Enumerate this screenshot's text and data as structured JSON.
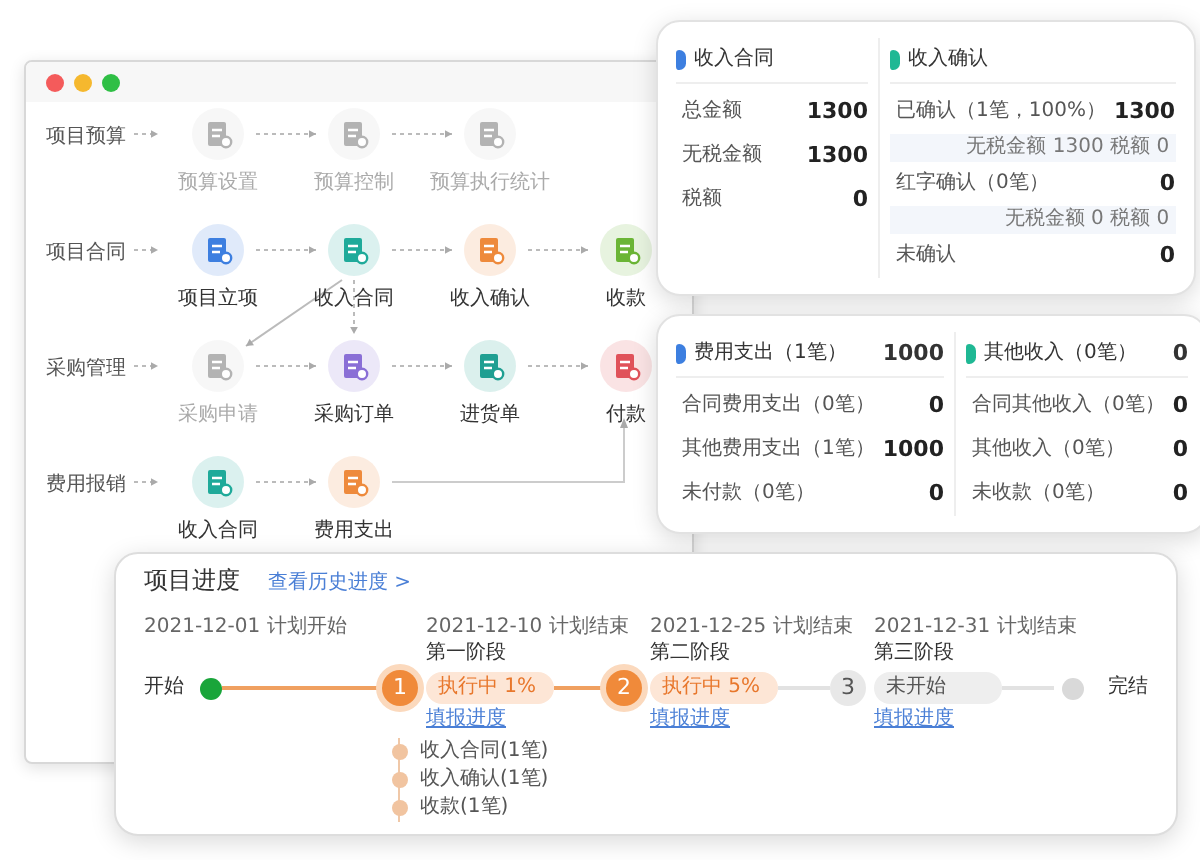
{
  "flow": {
    "rows": [
      {
        "label": "项目预算",
        "nodes": [
          {
            "label": "预算设置",
            "disabled": true,
            "color": "#b3b3b3"
          },
          {
            "label": "预算控制",
            "disabled": true,
            "color": "#b3b3b3"
          },
          {
            "label": "预算执行统计",
            "disabled": true,
            "color": "#b3b3b3"
          }
        ]
      },
      {
        "label": "项目合同",
        "nodes": [
          {
            "label": "项目立项",
            "disabled": false,
            "color": "#3d7fe0"
          },
          {
            "label": "收入合同",
            "disabled": false,
            "color": "#1faa9a"
          },
          {
            "label": "收入确认",
            "disabled": false,
            "color": "#ee8a3c"
          },
          {
            "label": "收款",
            "disabled": false,
            "color": "#6bb536"
          }
        ]
      },
      {
        "label": "采购管理",
        "nodes": [
          {
            "label": "采购申请",
            "disabled": true,
            "color": "#b3b3b3"
          },
          {
            "label": "采购订单",
            "disabled": false,
            "color": "#8a6fd6"
          },
          {
            "label": "进货单",
            "disabled": false,
            "color": "#1f9f92"
          },
          {
            "label": "付款",
            "disabled": false,
            "color": "#e0525a"
          }
        ]
      },
      {
        "label": "费用报销",
        "nodes": [
          {
            "label": "收入合同",
            "disabled": false,
            "color": "#1faa9a"
          },
          {
            "label": "费用支出",
            "disabled": false,
            "color": "#ee8a3c"
          }
        ]
      }
    ]
  },
  "summary_cards": [
    {
      "sections": [
        {
          "title": "收入合同",
          "color": "#3d7fe0",
          "rows": [
            {
              "kind": "row",
              "label": "总金额",
              "value": "1300"
            },
            {
              "kind": "row",
              "label": "无税金额",
              "value": "1300"
            },
            {
              "kind": "row",
              "label": "税额",
              "value": "0"
            }
          ]
        },
        {
          "title": "收入确认",
          "color": "#1fb894",
          "rows": [
            {
              "kind": "row",
              "label": "已确认（1笔，100%）",
              "value": "1300"
            },
            {
              "kind": "note",
              "label": "无税金额 1300 税额 0"
            },
            {
              "kind": "row",
              "label": "红字确认（0笔）",
              "value": "0"
            },
            {
              "kind": "note",
              "label": "无税金额 0 税额 0"
            },
            {
              "kind": "row",
              "label": "未确认",
              "value": "0"
            }
          ]
        }
      ]
    },
    {
      "sections": [
        {
          "title": "费用支出（1笔）",
          "total": "1000",
          "color": "#3d7fe0",
          "rows": [
            {
              "kind": "row",
              "label": "合同费用支出（0笔）",
              "value": "0"
            },
            {
              "kind": "row",
              "label": "其他费用支出（1笔）",
              "value": "1000"
            },
            {
              "kind": "row",
              "label": "未付款（0笔）",
              "value": "0"
            }
          ]
        },
        {
          "title": "其他收入（0笔）",
          "total": "0",
          "color": "#1fb894",
          "rows": [
            {
              "kind": "row",
              "label": "合同其他收入（0笔）",
              "value": "0"
            },
            {
              "kind": "row",
              "label": "其他收入（0笔）",
              "value": "0"
            },
            {
              "kind": "row",
              "label": "未收款（0笔）",
              "value": "0"
            }
          ]
        }
      ]
    }
  ],
  "progress": {
    "title": "项目进度",
    "history_link": "查看历史进度 >",
    "start": {
      "date": "2021-12-01 计划开始",
      "label": "开始"
    },
    "stages": [
      {
        "number": "1",
        "date": "2021-12-10 计划结束",
        "name": "第一阶段",
        "kind": "active",
        "status_text": "执行中",
        "percent": "1%",
        "link": "填报进度",
        "items": [
          "收入合同(1笔)",
          "收入确认(1笔)",
          "收款(1笔)"
        ]
      },
      {
        "number": "2",
        "date": "2021-12-25 计划结束",
        "name": "第二阶段",
        "kind": "active",
        "status_text": "执行中",
        "percent": "5%",
        "link": "填报进度"
      },
      {
        "number": "3",
        "date": "2021-12-31 计划结束",
        "name": "第三阶段",
        "kind": "pending",
        "status_text": "未开始",
        "link": "填报进度"
      }
    ],
    "end": {
      "label": "完结"
    }
  }
}
